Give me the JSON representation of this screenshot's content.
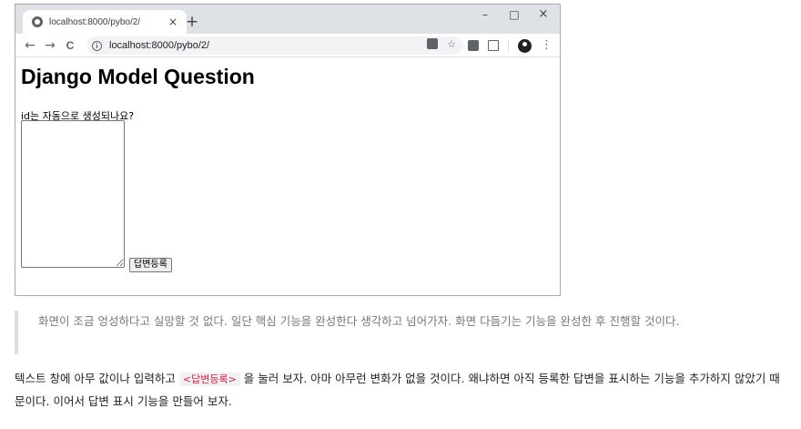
{
  "browser": {
    "tab": {
      "title": "localhost:8000/pybo/2/",
      "close": "×"
    },
    "new_tab": "+",
    "window_controls": {
      "minimize": "–",
      "maximize": "□",
      "close": "×"
    },
    "nav": {
      "back": "←",
      "forward": "→",
      "reload": "C"
    },
    "address": {
      "info": "i",
      "url": "localhost:8000/pybo/2/"
    },
    "icons": {
      "translate": "translate-icon",
      "bookmark": "star-icon",
      "extension": "extension-icon",
      "media": "media-icon",
      "profile": "avatar-icon",
      "menu": "kebab-menu-icon"
    },
    "star": "☆",
    "kebab": "⋮"
  },
  "page": {
    "heading": "Django Model Question",
    "textarea_label": "id는 자동으로 생성되나요?",
    "textarea_value": "",
    "submit_label": "답변등록"
  },
  "article": {
    "quote": "화면이 조금 엉성하다고 실망할 것 없다. 일단 핵심 기능을 완성한다 생각하고 넘어가자. 화면 다듬기는 기능을 완성한 후 진행할 것이다.",
    "para_before": "텍스트 창에 아무 값이나 입력하고 ",
    "para_code": "<답변등록>",
    "para_after": " 을 눌러 보자. 아마 아무런 변화가 없을 것이다. 왜냐하면 아직 등록한 답변을 표시하는 기능을 추가하지 않았기 때문이다. 이어서 답변 표시 기능을 만들어 보자."
  },
  "colors": {
    "titlebar": "#dee1e6",
    "omnibox": "#f1f3f4",
    "quote_text": "#777777",
    "code_text": "#c7254e"
  }
}
